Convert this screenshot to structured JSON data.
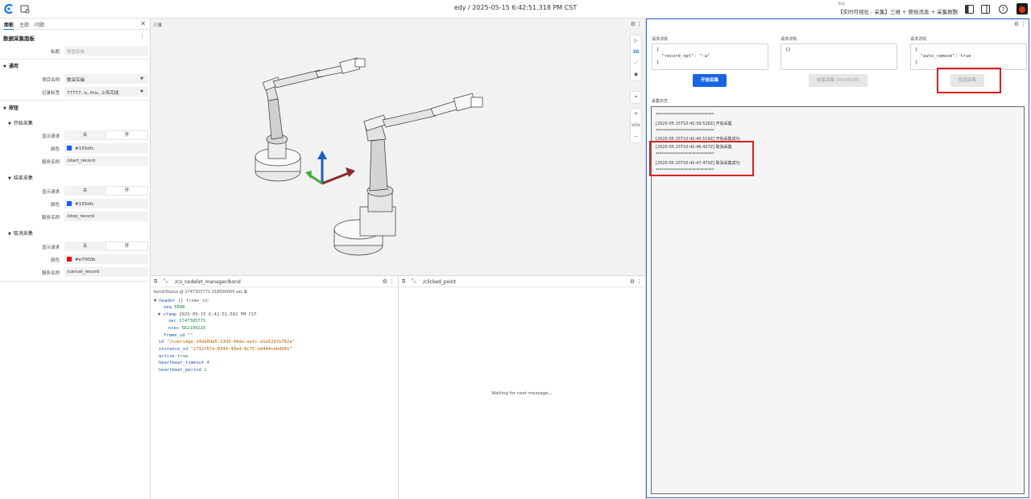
{
  "topbar": {
    "center_title": "edy / 2025-05-15 6:42:51.318 PM CST",
    "layout_small": "布局",
    "layout_name": "【实时可视化 - 采集】三维 + 原始消息 + 采集数据",
    "logo_color": "#1a73e8"
  },
  "sidebar": {
    "tabs": [
      "面板",
      "主题",
      "问题"
    ],
    "title": "数据采集面板",
    "title_field": {
      "label": "标题",
      "placeholder": "数据采集"
    },
    "general": {
      "heading": "通用",
      "project_label": "项目名称",
      "project_value": "数采实操",
      "tags_label": "记录标签",
      "tags_value": "77777, is, this, 上传完成"
    },
    "buttons_heading": "按钮",
    "show_request_label": "显示请求",
    "color_label": "颜色",
    "service_label": "服务名称",
    "toggle_off": "关",
    "toggle_on": "开",
    "groups": [
      {
        "name": "开始采集",
        "color": "#155dfc",
        "color_text": "#155dfc",
        "service": "/start_record"
      },
      {
        "name": "结束采集",
        "color": "#155dfc",
        "color_text": "#155dfc",
        "service": "/stop_record"
      },
      {
        "name": "取消采集",
        "color": "#e7000b",
        "color_text": "#e7000b",
        "service": "/cancel_record"
      }
    ]
  },
  "panel3d": {
    "title": "三维",
    "tool_3d_label": "3D",
    "zoom_label": "191%"
  },
  "bond_panel": {
    "topic": "/co_nodelet_manager/bond",
    "status_line": "bond/Status @ 1747305771.318000000 sec",
    "lines": {
      "header": "header",
      "header_note": "{} frame_id:",
      "seq_key": "seq",
      "seq_val": "5898",
      "stamp_key": "stamp",
      "stamp_val": "2025-05-15 6:42:51.562 PM CST",
      "sec_key": "sec",
      "sec_val": "1747305771",
      "nsec_key": "nsec",
      "nsec_val": "562199225",
      "frame_id_key": "frame_id",
      "frame_id_val": "\"\"",
      "id_key": "id",
      "id_val": "\"/cobridge_24da0da5-23d3-49da-aafc-a1e5297e762a\"",
      "instance_key": "instance_id",
      "instance_val": "\"c732f67a-8344-49a4-8c75-2d444ceb4991\"",
      "active_key": "active",
      "active_val": "true",
      "hb_timeout_key": "heartbeat_timeout",
      "hb_timeout_val": "4",
      "hb_period_key": "heartbeat_period",
      "hb_period_val": "1"
    }
  },
  "clicked_panel": {
    "topic": "/clicked_point",
    "waiting": "Waiting for next message..."
  },
  "right_panel": {
    "requests": [
      {
        "label": "请求详情",
        "body": "{\n  \"record_opt\": \"-a\"\n}"
      },
      {
        "label": "请求详情",
        "body": "{}"
      },
      {
        "label": "请求详情",
        "body": "{\n  \"auto_remove\": true\n}"
      }
    ],
    "buttons": [
      {
        "label": "开始采集",
        "state": "enabled"
      },
      {
        "label": "结束采集 (00:00:00)",
        "state": "disabled"
      },
      {
        "label": "取消采集",
        "state": "disabled"
      }
    ],
    "log_label": "采集日志",
    "log_lines": [
      "*****************************",
      "[2025-05-15T10:42:39.526Z] 开始采集",
      "*****************************",
      "[2025-05-15T10:42:40.519Z] 开始采集成功",
      "[2025-05-15T10:42:46.427Z] 取消采集",
      "*****************************",
      "[2025-05-15T10:42:47.470Z] 取消采集成功",
      "*****************************"
    ],
    "highlight_color": "#d92020"
  }
}
